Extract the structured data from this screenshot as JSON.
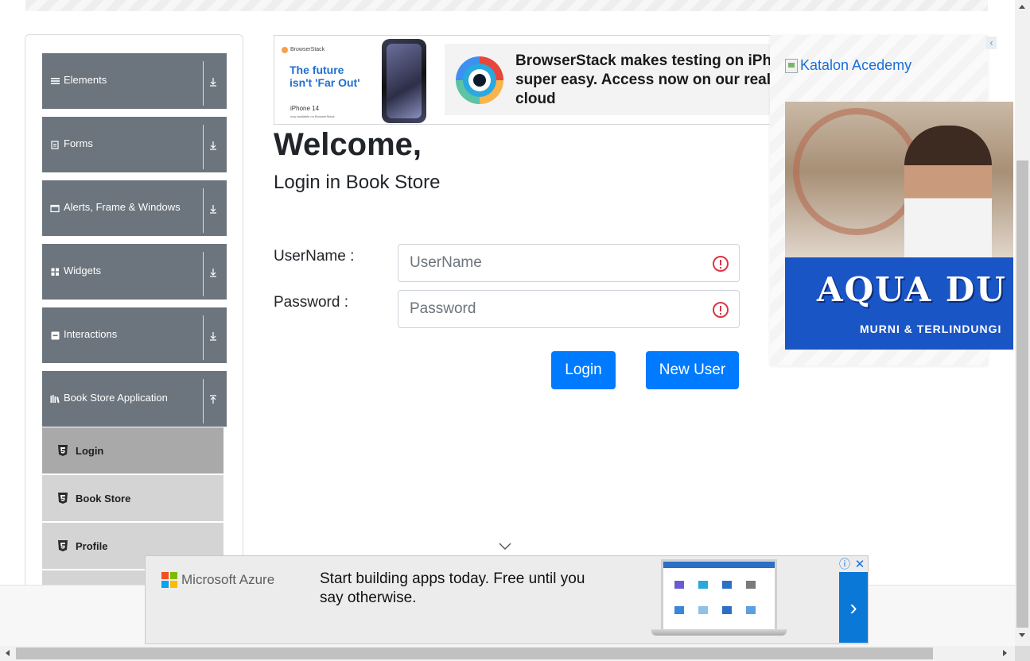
{
  "sidebar": {
    "groups": [
      {
        "label": "Elements",
        "icon": "hamburger-icon"
      },
      {
        "label": "Forms",
        "icon": "form-icon"
      },
      {
        "label": "Alerts, Frame & Windows",
        "icon": "window-icon"
      },
      {
        "label": "Widgets",
        "icon": "grid-icon"
      },
      {
        "label": "Interactions",
        "icon": "interaction-icon"
      },
      {
        "label": "Book Store Application",
        "icon": "books-icon",
        "expanded": true
      }
    ],
    "book_store_items": [
      {
        "label": "Login",
        "active": true
      },
      {
        "label": "Book Store",
        "active": false
      },
      {
        "label": "Profile",
        "active": false
      }
    ]
  },
  "top_ad": {
    "brand": "BrowserStack",
    "left_headline_1": "The future",
    "left_headline_2": "isn't 'Far Out'",
    "device": "iPhone 14",
    "device_note": "now available on BrowserStack",
    "text_line_1": "BrowserStack makes testing on iPho",
    "text_line_2": "super easy. Access now on our real",
    "text_line_3": "cloud"
  },
  "main": {
    "title": "Welcome,",
    "subtitle": "Login in Book Store",
    "username_label": "UserName :",
    "username_placeholder": "UserName",
    "username_value": "",
    "password_label": "Password :",
    "password_placeholder": "Password",
    "password_value": "",
    "login_button": "Login",
    "new_user_button": "New User"
  },
  "right_ad": {
    "link_text": "Katalon Acedemy",
    "brand_word_1": "AQUA",
    "brand_word_2": "DU",
    "tagline": "MURNI & TERLINDUNGI"
  },
  "bottom_ad": {
    "advertiser": "Microsoft Azure",
    "headline": "Start building apps today. Free until you say otherwise.",
    "next_glyph": "›",
    "info_glyph": "ⓘ",
    "close_glyph": "✕"
  },
  "colors": {
    "sidebar_header": "#6c757d",
    "sub_item": "#d4d4d4",
    "sub_item_active": "#a9a9a9",
    "primary_button": "#007bff",
    "error": "#dc3545"
  }
}
